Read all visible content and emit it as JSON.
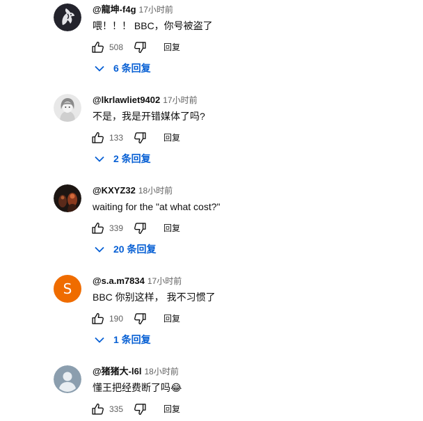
{
  "comments": [
    {
      "author": "@龍坤-f4g",
      "time": "17小时前",
      "text": "喂！！！ BBC，你号被盗了",
      "likes": "508",
      "reply_label": "回复",
      "replies_label": "6 条回复",
      "avatar_icon": "dragon-avatar-icon"
    },
    {
      "author": "@lkrlawliet9402",
      "time": "17小时前",
      "text": "不是，我是开错媒体了吗?",
      "likes": "133",
      "reply_label": "回复",
      "replies_label": "2 条回复",
      "avatar_icon": "anime-character-avatar-icon"
    },
    {
      "author": "@KXYZ32",
      "time": "18小时前",
      "text": "waiting for the \"at what cost?\"",
      "likes": "339",
      "reply_label": "回复",
      "replies_label": "20 条回复",
      "avatar_icon": "dark-figure-avatar-icon"
    },
    {
      "author": "@s.a.m7834",
      "time": "17小时前",
      "text": "BBC 你别这样， 我不习惯了",
      "likes": "190",
      "reply_label": "回复",
      "replies_label": "1 条回复",
      "avatar_letter": "S",
      "avatar_color": "#ef6c00"
    },
    {
      "author": "@猪猪大-l6l",
      "time": "18小时前",
      "text": "懂王把经费断了吗",
      "emoji": "😂",
      "likes": "335",
      "reply_label": "回复",
      "avatar_icon": "default-person-avatar-icon",
      "avatar_color": "#8b9eae"
    }
  ],
  "colors": {
    "link_blue": "#065fd4",
    "secondary_text": "#606060"
  }
}
